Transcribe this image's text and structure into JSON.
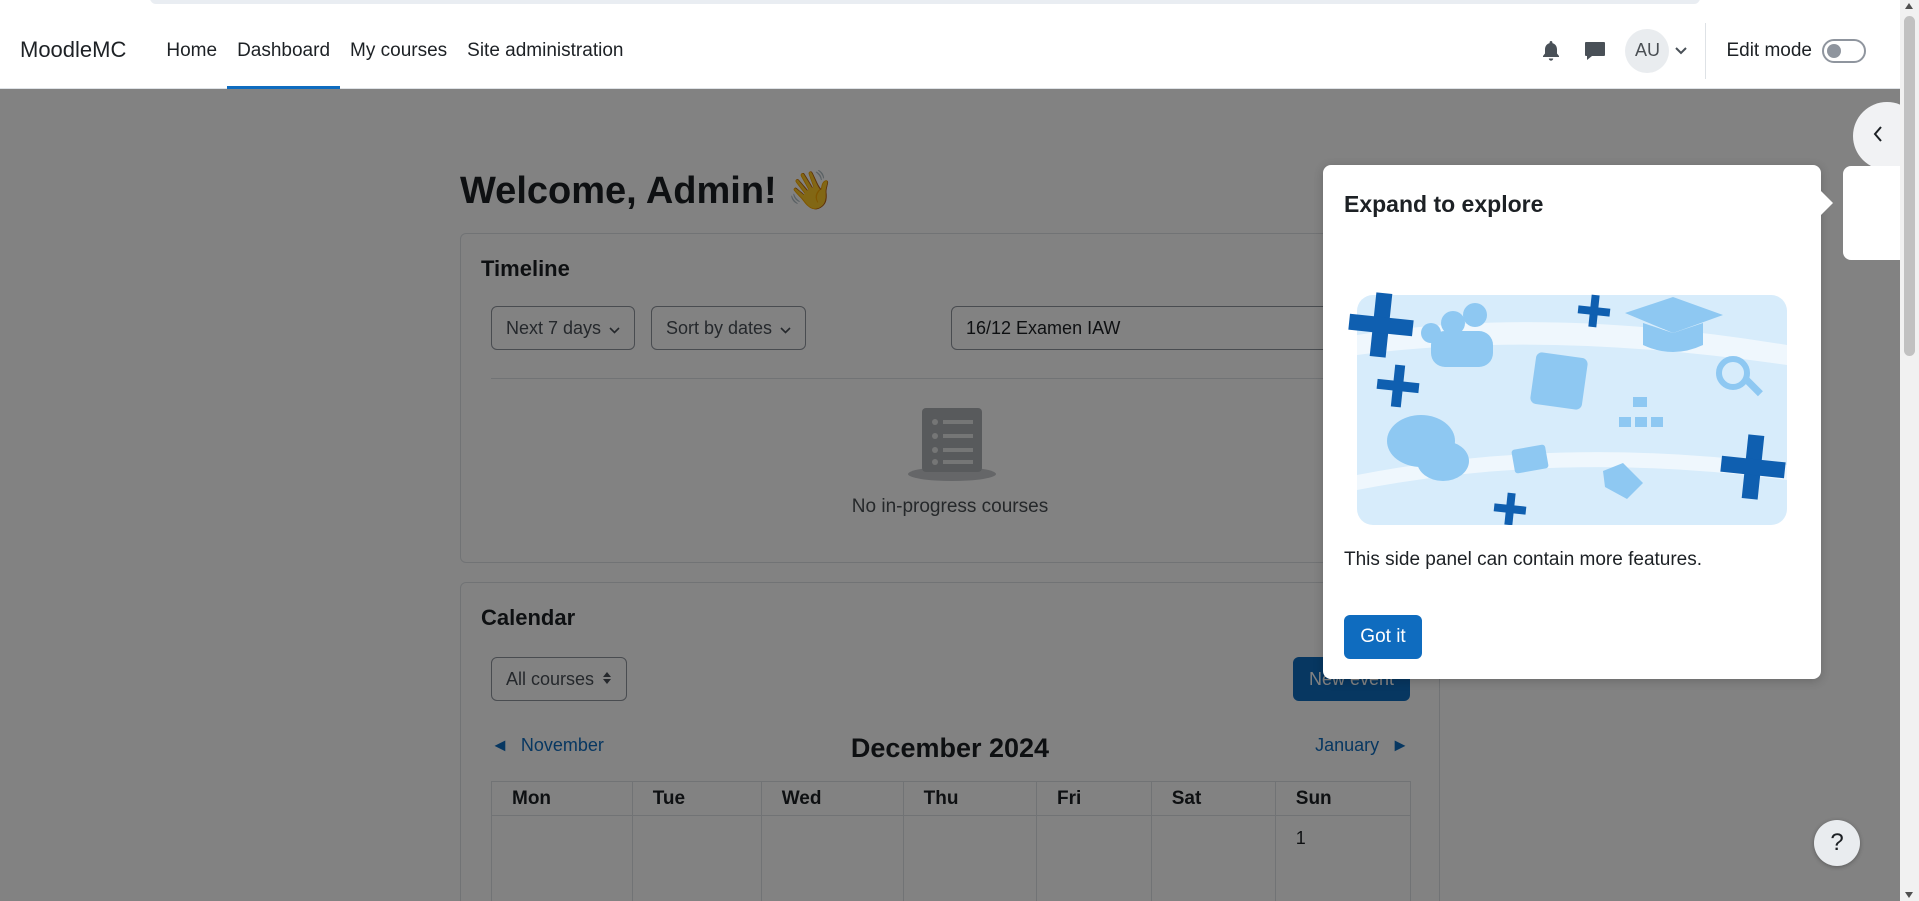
{
  "site": {
    "brand": "MoodleMC"
  },
  "nav": {
    "items": [
      {
        "label": "Home"
      },
      {
        "label": "Dashboard"
      },
      {
        "label": "My courses"
      },
      {
        "label": "Site administration"
      }
    ],
    "active": "Dashboard"
  },
  "user": {
    "initials": "AU",
    "edit_mode_label": "Edit mode",
    "edit_mode_on": false
  },
  "page": {
    "welcome": "Welcome, Admin! 👋"
  },
  "timeline": {
    "title": "Timeline",
    "filter_days": "Next 7 days",
    "sort": "Sort by dates",
    "search_value": "16/12 Examen IAW",
    "empty_message": "No in-progress courses"
  },
  "calendar": {
    "title": "Calendar",
    "course_filter": "All courses",
    "new_event_label": "New event",
    "prev_month": "November",
    "current_month": "December 2024",
    "next_month": "January",
    "weekdays": [
      "Mon",
      "Tue",
      "Wed",
      "Thu",
      "Fri",
      "Sat",
      "Sun"
    ],
    "first_week": [
      "",
      "",
      "",
      "",
      "",
      "",
      "1"
    ]
  },
  "tour": {
    "title": "Expand to explore",
    "body": "This side panel can contain more features.",
    "button": "Got it"
  },
  "help": {
    "label": "?"
  },
  "colors": {
    "primary": "#0f6cbf",
    "overlay": "rgba(0,0,0,0.49)",
    "illustration_dark": "#0f5fb0",
    "illustration_light": "#9fd0f5"
  }
}
